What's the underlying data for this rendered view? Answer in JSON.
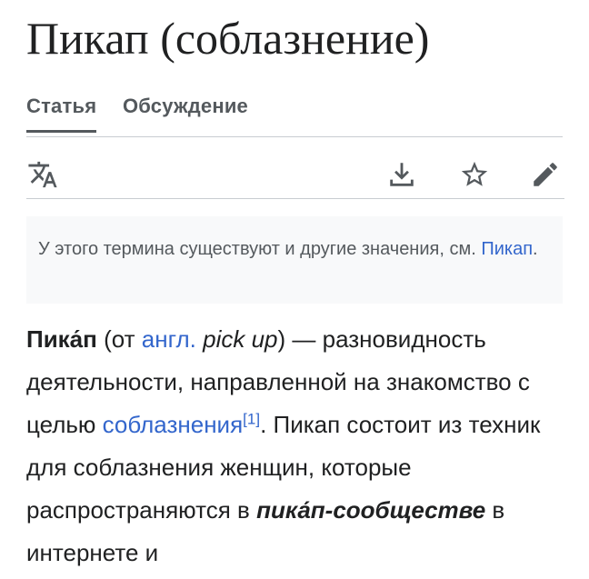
{
  "page": {
    "title": "Пикап (соблазнение)"
  },
  "tabs": [
    {
      "label": "Статья"
    },
    {
      "label": "Обсуждение"
    }
  ],
  "toolbar": {
    "icons": [
      "language-icon",
      "download-icon",
      "star-icon",
      "edit-icon"
    ]
  },
  "hatnote": {
    "text": "У этого термина существуют и другие значения, см. ",
    "link": "Пикап",
    "end": "."
  },
  "article": {
    "term": "Пика́п",
    "open_paren": " (от ",
    "lang_link": "англ.",
    "space": " ",
    "foreign": "pick up",
    "after_foreign": ") — разновидность деятельности, направленной на знакомство с целью ",
    "link_seduction": "соблазнения",
    "ref": "[1]",
    "after_ref": ". Пикап состоит из техник для соблазнения женщин, которые распространяются в ",
    "community": "пика́п-сообществе",
    "tail": " в интернете и"
  },
  "colors": {
    "link": "#3366cc",
    "text": "#202122",
    "muted": "#54595d",
    "hatnote_bg": "#f8f9fa",
    "border": "#c8ccd1"
  }
}
